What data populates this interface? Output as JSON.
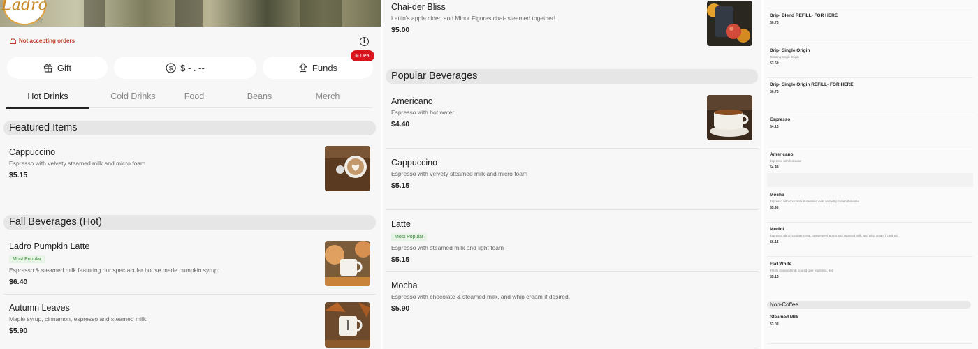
{
  "left": {
    "status_text": "Not accepting orders",
    "buttons": {
      "gift": "Gift",
      "balance": "$ - . --",
      "funds": "Funds",
      "deal_badge": "Deal"
    },
    "tabs": [
      "Hot Drinks",
      "Cold Drinks",
      "Food",
      "Beans",
      "Merch"
    ],
    "sections": {
      "featured": "Featured Items",
      "fall": "Fall Beverages (Hot)"
    },
    "featured": [
      {
        "name": "Cappuccino",
        "desc": "Espresso with velvety steamed milk and micro foam",
        "price": "$5.15"
      }
    ],
    "fall": [
      {
        "name": "Ladro Pumpkin Latte",
        "badge": "Most Popular",
        "desc": "Espresso & steamed milk featuring our spectacular house made pumpkin syrup.",
        "price": "$6.40"
      },
      {
        "name": "Autumn Leaves",
        "desc": "Maple syrup, cinnamon, espresso and steamed milk.",
        "price": "$5.90"
      }
    ]
  },
  "middle": {
    "top_item": {
      "name": "Chai-der Bliss",
      "desc": "Lattin's apple cider, and Minor Figures chai- steamed together!",
      "price": "$5.00"
    },
    "section": "Popular Beverages",
    "items": [
      {
        "name": "Americano",
        "desc": "Espresso with hot water",
        "price": "$4.40"
      },
      {
        "name": "Cappuccino",
        "desc": "Espresso with velvety steamed milk and micro foam",
        "price": "$5.15"
      },
      {
        "name": "Latte",
        "badge": "Most Popular",
        "desc": "Espresso with steamed milk and light foam",
        "price": "$5.15"
      },
      {
        "name": "Mocha",
        "desc": "Espresso with chocolate & steamed milk, and whip cream if desired.",
        "price": "$5.90"
      }
    ]
  },
  "right": {
    "items": [
      {
        "name": "Drip- Blend REFILL- FOR HERE",
        "desc": "",
        "price": "$0.75"
      },
      {
        "name": "Drip- Single Origin",
        "desc": "Rotating Single Origin",
        "price": "$3.60"
      },
      {
        "name": "Drip- Single Origin REFILL- FOR HERE",
        "desc": "",
        "price": "$0.75"
      },
      {
        "name": "Espresso",
        "desc": "",
        "price": "$4.15"
      },
      {
        "name": "Americano",
        "desc": "Espresso with hot water",
        "price": "$4.40"
      },
      {
        "name": "Mocha",
        "desc": "Espresso with chocolate & steamed milk, and whip cream if desired.",
        "price": "$5.90"
      },
      {
        "name": "Medici",
        "desc": "Espresso with chocolate syrup, orange peel & zest and steamed milk, and whip cream if desired.",
        "price": "$6.15"
      },
      {
        "name": "Flat White",
        "desc": "Fresh, steamed milk poured over espresso, 8oz",
        "price": "$5.15"
      }
    ],
    "section": "Non-Coffee",
    "after_section": [
      {
        "name": "Steamed Milk",
        "desc": "",
        "price": "$3.00"
      }
    ]
  },
  "colors": {
    "status_red": "#c0392b",
    "deal_red": "#d7151b",
    "logo_gold": "#e2a240",
    "badge_green": "#3a8a3a"
  }
}
